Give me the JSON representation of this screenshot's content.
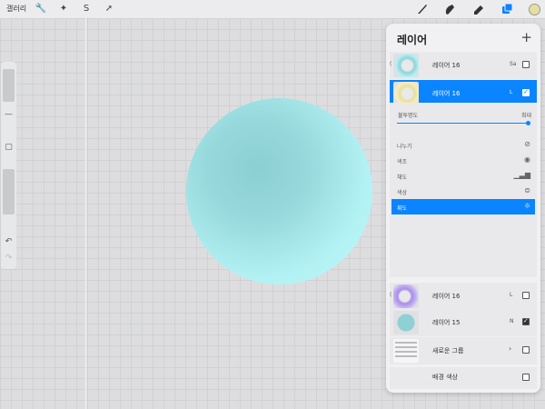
{
  "topbar": {
    "gallery_label": "갤러리",
    "color_swatch": "#e7dfa0"
  },
  "sidebar": {
    "undo_icon": "undo-icon",
    "redo_icon": "redo-icon"
  },
  "layers_panel": {
    "title": "레이어",
    "add_label": "+",
    "layers": [
      {
        "name": "레이어 16",
        "blend": "Sa",
        "visible": false,
        "active": false
      },
      {
        "name": "레이어 16",
        "blend": "L",
        "visible": true,
        "active": true
      },
      {
        "name": "레이어 16",
        "blend": "L",
        "visible": false,
        "active": false
      },
      {
        "name": "레이어 15",
        "blend": "N",
        "visible": true,
        "active": false
      },
      {
        "name": "새로운 그룹",
        "blend": "",
        "visible": false,
        "active": false,
        "group": true
      },
      {
        "name": "배경 색상",
        "blend": "",
        "visible": false,
        "active": false
      }
    ],
    "options": {
      "opacity_label": "불투명도",
      "opacity_max": "최대",
      "opacity_value": 1.0,
      "items": [
        {
          "label": "나누기",
          "icon": "divide-icon",
          "active": false
        },
        {
          "label": "색조",
          "icon": "hue-icon",
          "active": false
        },
        {
          "label": "채도",
          "icon": "saturation-icon",
          "active": false
        },
        {
          "label": "색상",
          "icon": "color-icon",
          "active": false
        },
        {
          "label": "휘도",
          "icon": "luminosity-icon",
          "active": true
        }
      ]
    }
  },
  "colors": {
    "accent": "#0a84ff",
    "circle": "#b3f2f4"
  }
}
